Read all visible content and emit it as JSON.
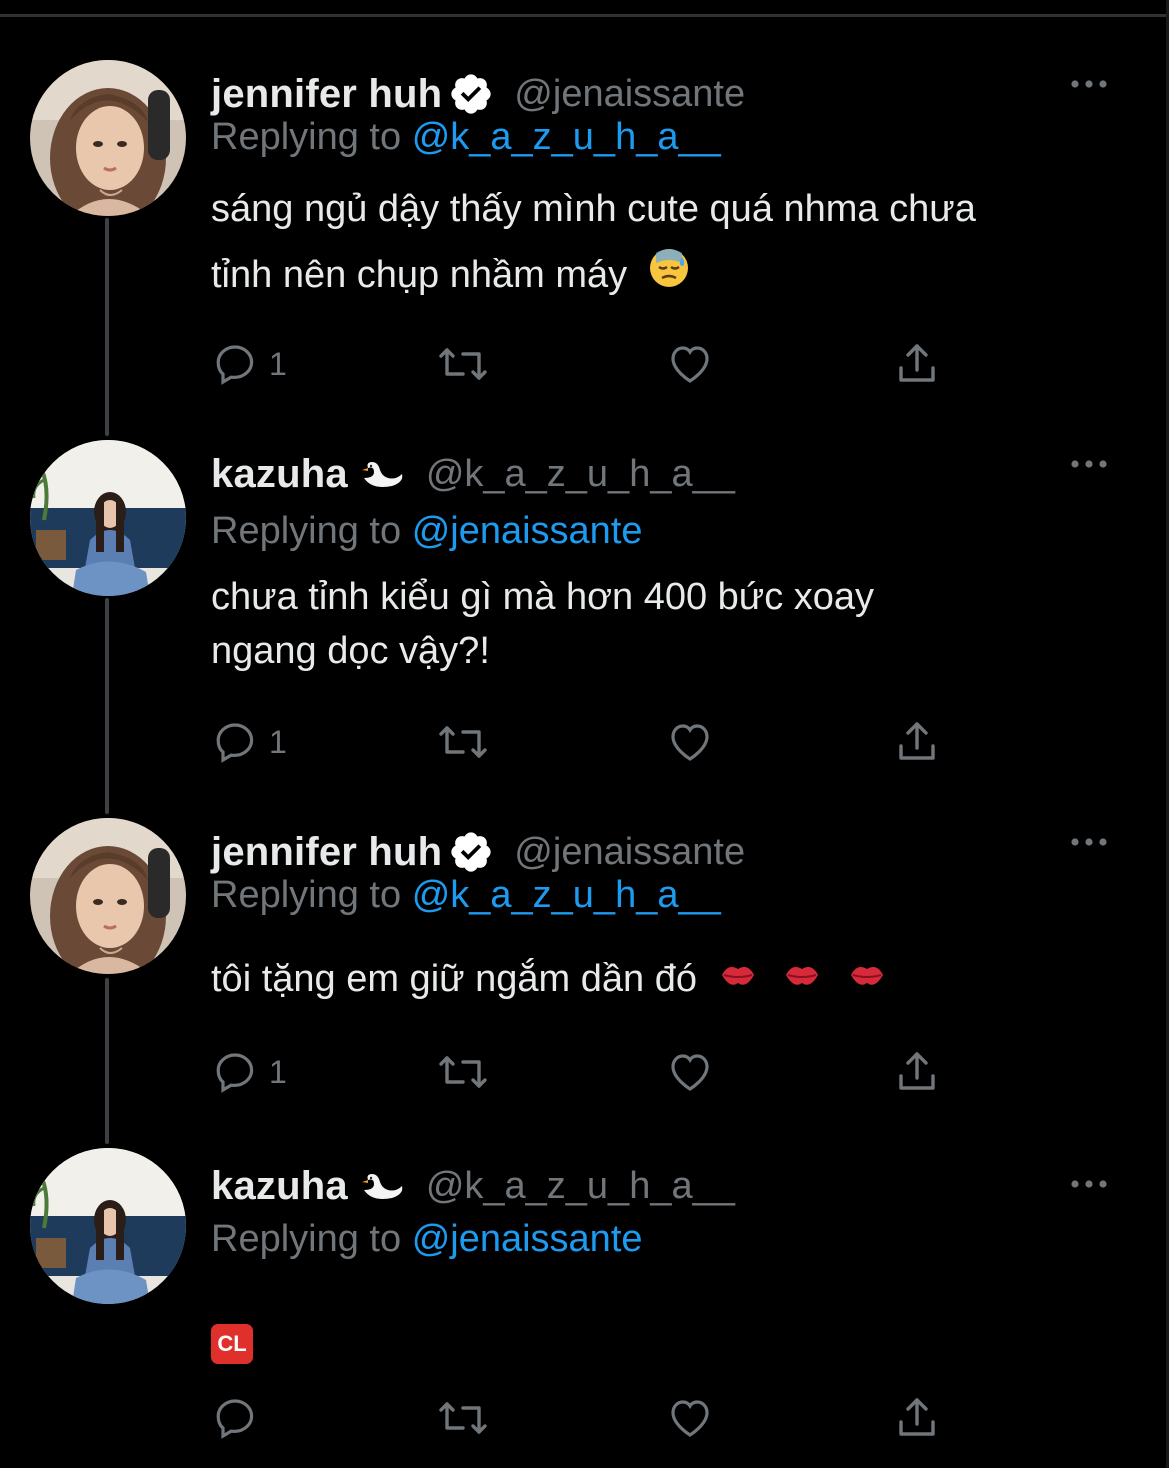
{
  "colors": {
    "background": "#000000",
    "text_primary": "#e7e9ea",
    "text_secondary": "#71767b",
    "link_blue": "#1d9bf0",
    "thread_line": "#3e4144",
    "verified_badge": "#ffffff"
  },
  "tweets": [
    {
      "author": {
        "name": "jennifer huh",
        "handle": "@jenaissante",
        "verified": true,
        "name_emoji": "",
        "avatar_icon": "avatar-jennifer"
      },
      "replying_prefix": "Replying to",
      "replying_to": "@k_a_z_u_h_a__",
      "lines": [
        "sáng ngủ dậy thấy mình cute quá nhma chưa",
        "tỉnh nên chụp nhầm máy"
      ],
      "trailing_emoji": "downcast-face-with-sweat-emoji",
      "reply_count": "1",
      "more_icon": "more-dots-icon"
    },
    {
      "author": {
        "name": "kazuha",
        "handle": "@k_a_z_u_h_a__",
        "verified": false,
        "name_emoji": "swan-emoji",
        "avatar_icon": "avatar-kazuha"
      },
      "replying_prefix": "Replying to",
      "replying_to": "@jenaissante",
      "lines": [
        "chưa tỉnh kiểu gì mà hơn 400 bức xoay",
        "ngang dọc vậy?!"
      ],
      "trailing_emoji": "",
      "reply_count": "1",
      "more_icon": "more-dots-icon"
    },
    {
      "author": {
        "name": "jennifer huh",
        "handle": "@jenaissante",
        "verified": true,
        "name_emoji": "",
        "avatar_icon": "avatar-jennifer"
      },
      "replying_prefix": "Replying to",
      "replying_to": "@k_a_z_u_h_a__",
      "lines": [
        "tôi tặng em giữ ngắm dần đó"
      ],
      "trailing_emoji": "kiss-mark-emoji x3",
      "reply_count": "1",
      "more_icon": "more-dots-icon"
    },
    {
      "author": {
        "name": "kazuha",
        "handle": "@k_a_z_u_h_a__",
        "verified": false,
        "name_emoji": "swan-emoji",
        "avatar_icon": "avatar-kazuha"
      },
      "replying_prefix": "Replying to",
      "replying_to": "@jenaissante",
      "lines": [],
      "content_badge": "CL",
      "trailing_emoji": "cl-button-emoji",
      "reply_count": "",
      "more_icon": "more-dots-icon"
    }
  ],
  "action_icons": [
    "reply-icon",
    "retweet-icon",
    "like-icon",
    "share-icon"
  ]
}
